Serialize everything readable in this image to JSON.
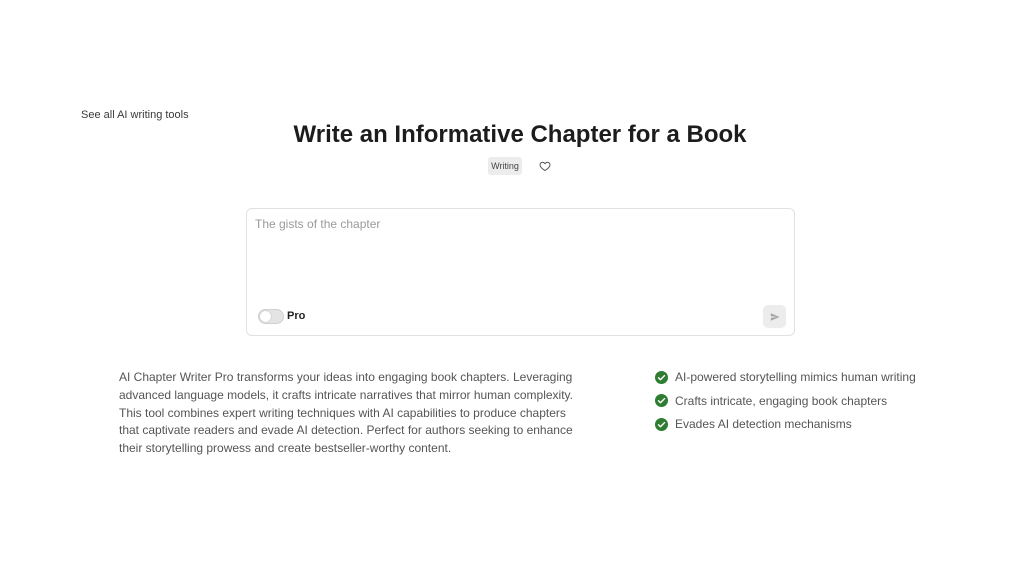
{
  "nav": {
    "back_link": "See all AI writing tools"
  },
  "header": {
    "title": "Write an Informative Chapter for a Book",
    "tag": "Writing",
    "favorite_icon": "heart-outline-icon"
  },
  "composer": {
    "placeholder": "The gists of the chapter",
    "value": "",
    "pro_toggle": {
      "label": "Pro",
      "enabled": false
    },
    "send_icon": "send-icon"
  },
  "description": "AI Chapter Writer Pro transforms your ideas into engaging book chapters. Leveraging advanced language models, it crafts intricate narratives that mirror human complexity. This tool combines expert writing techniques with AI capabilities to produce chapters that captivate readers and evade AI detection. Perfect for authors seeking to enhance their storytelling prowess and create bestseller-worthy content.",
  "features": [
    "AI-powered storytelling mimics human writing",
    "Crafts intricate, engaging book chapters",
    "Evades AI detection mechanisms"
  ],
  "colors": {
    "check": "#2e7d32",
    "tag_bg": "#ececec",
    "border": "#e1e1e1"
  }
}
